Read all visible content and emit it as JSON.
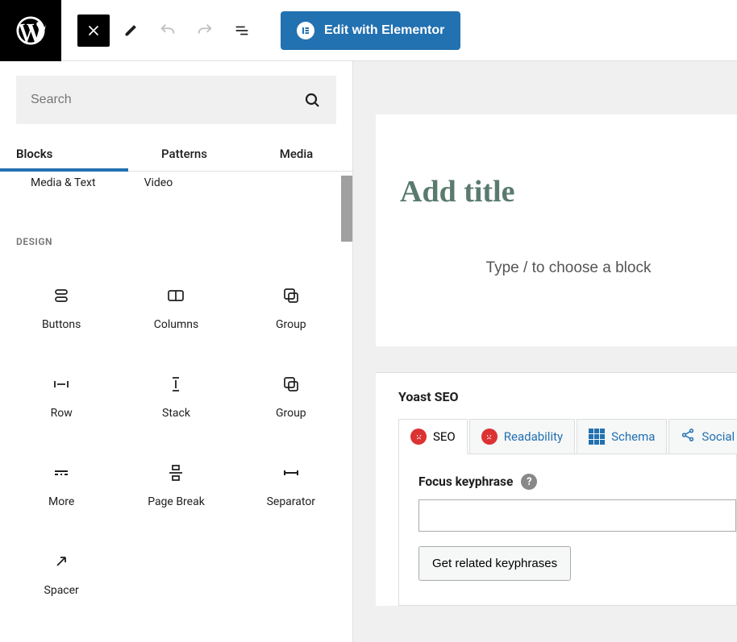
{
  "toolbar": {
    "elementor_label": "Edit with Elementor"
  },
  "inserter": {
    "search_placeholder": "Search",
    "tabs": {
      "blocks": "Blocks",
      "patterns": "Patterns",
      "media": "Media"
    },
    "top_items": {
      "media_text": "Media & Text",
      "video": "Video"
    },
    "section_design": "DESIGN",
    "blocks": {
      "buttons": "Buttons",
      "columns": "Columns",
      "group": "Group",
      "row": "Row",
      "stack": "Stack",
      "group2": "Group",
      "more": "More",
      "pagebreak": "Page Break",
      "separator": "Separator",
      "spacer": "Spacer"
    }
  },
  "editor": {
    "title_placeholder": "Add title",
    "content_placeholder": "Type / to choose a block"
  },
  "yoast": {
    "panel_title": "Yoast SEO",
    "tabs": {
      "seo": "SEO",
      "readability": "Readability",
      "schema": "Schema",
      "social": "Social"
    },
    "focus_keyphrase_label": "Focus keyphrase",
    "related_btn": "Get related keyphrases"
  }
}
